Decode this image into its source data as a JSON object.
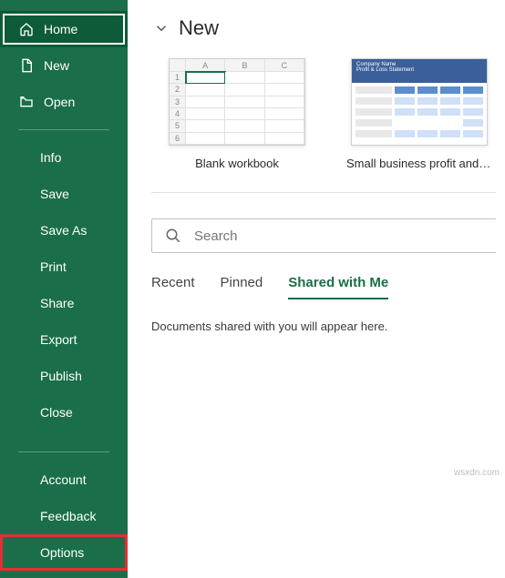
{
  "sidebar": {
    "top": [
      {
        "label": "Home",
        "icon": "home-icon",
        "selected": true
      },
      {
        "label": "New",
        "icon": "new-icon"
      },
      {
        "label": "Open",
        "icon": "open-icon"
      }
    ],
    "middle": [
      {
        "label": "Info"
      },
      {
        "label": "Save"
      },
      {
        "label": "Save As"
      },
      {
        "label": "Print"
      },
      {
        "label": "Share"
      },
      {
        "label": "Export"
      },
      {
        "label": "Publish"
      },
      {
        "label": "Close"
      }
    ],
    "bottom": [
      {
        "label": "Account"
      },
      {
        "label": "Feedback"
      },
      {
        "label": "Options",
        "highlight": true
      }
    ]
  },
  "main": {
    "section_title": "New",
    "templates": [
      {
        "label": "Blank workbook",
        "thumb_cols": [
          "A",
          "B",
          "C"
        ],
        "thumb_rows": [
          "1",
          "2",
          "3",
          "4",
          "5",
          "6"
        ]
      },
      {
        "label": "Small business profit and los...",
        "pl_title": "Company Name",
        "pl_subtitle": "Profit & Loss Statement"
      }
    ],
    "search_placeholder": "Search",
    "tabs": [
      {
        "label": "Recent"
      },
      {
        "label": "Pinned"
      },
      {
        "label": "Shared with Me",
        "active": true
      }
    ],
    "empty_state": "Documents shared with you will appear here."
  },
  "watermark": "wsxdn.com"
}
